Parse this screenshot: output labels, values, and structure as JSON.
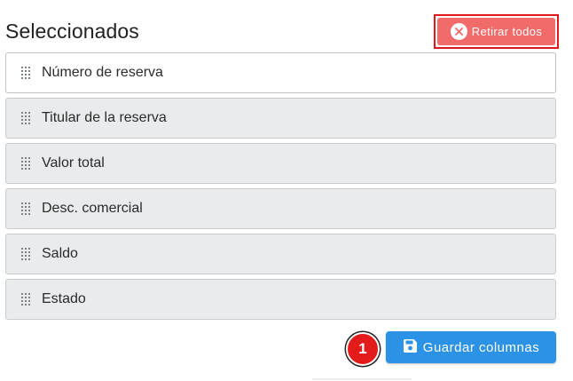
{
  "header": {
    "title": "Seleccionados",
    "remove_all_label": "Retirar todos"
  },
  "selected_columns": [
    {
      "label": "Número de reserva"
    },
    {
      "label": "Titular de la reserva"
    },
    {
      "label": "Valor total"
    },
    {
      "label": "Desc. comercial"
    },
    {
      "label": "Saldo"
    },
    {
      "label": "Estado"
    }
  ],
  "footer": {
    "step_badge": "1",
    "save_label": "Guardar columnas"
  },
  "colors": {
    "remove_button": "#f26b6b",
    "remove_highlight": "#e0181c",
    "save_button": "#2b92e6",
    "badge": "#e31b1b"
  },
  "icons": {
    "remove": "close-circle-icon",
    "save": "floppy-disk-icon",
    "drag": "drag-handle-icon"
  }
}
